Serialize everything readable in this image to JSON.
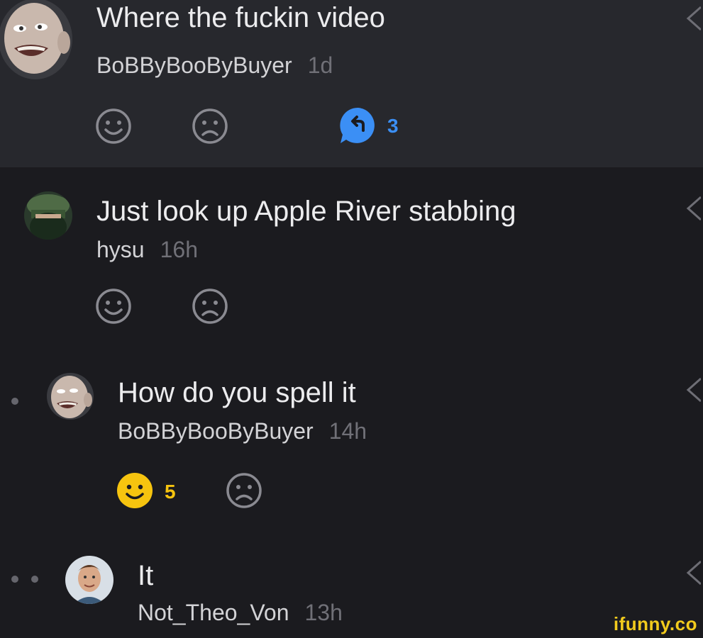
{
  "colors": {
    "background": "#1b1b1f",
    "highlight_row": "#27282d",
    "accent_blue": "#3b8ff5",
    "accent_yellow": "#f6c40f"
  },
  "comments": [
    {
      "text": "Where the fuckin video",
      "username": "BoBByBooByBuyer",
      "time": "1d",
      "replies_count": "3",
      "icons": [
        "bald-man-avatar",
        "smile-icon",
        "frown-icon",
        "reply-bubble-icon",
        "share-icon"
      ]
    },
    {
      "text": "Just look up Apple River stabbing",
      "username": "hysu",
      "time": "16h",
      "icons": [
        "masked-soldier-avatar",
        "smile-icon",
        "frown-icon",
        "share-icon"
      ]
    },
    {
      "text": "How do you spell it",
      "username": "BoBByBooByBuyer",
      "time": "14h",
      "smile_count": "5",
      "icons": [
        "bald-man-avatar",
        "smile-icon-active",
        "frown-icon",
        "share-icon"
      ]
    },
    {
      "text": "It",
      "username": "Not_Theo_Von",
      "time": "13h",
      "icons": [
        "man-portrait-avatar",
        "share-icon"
      ]
    }
  ],
  "watermark": "ifunny.co"
}
